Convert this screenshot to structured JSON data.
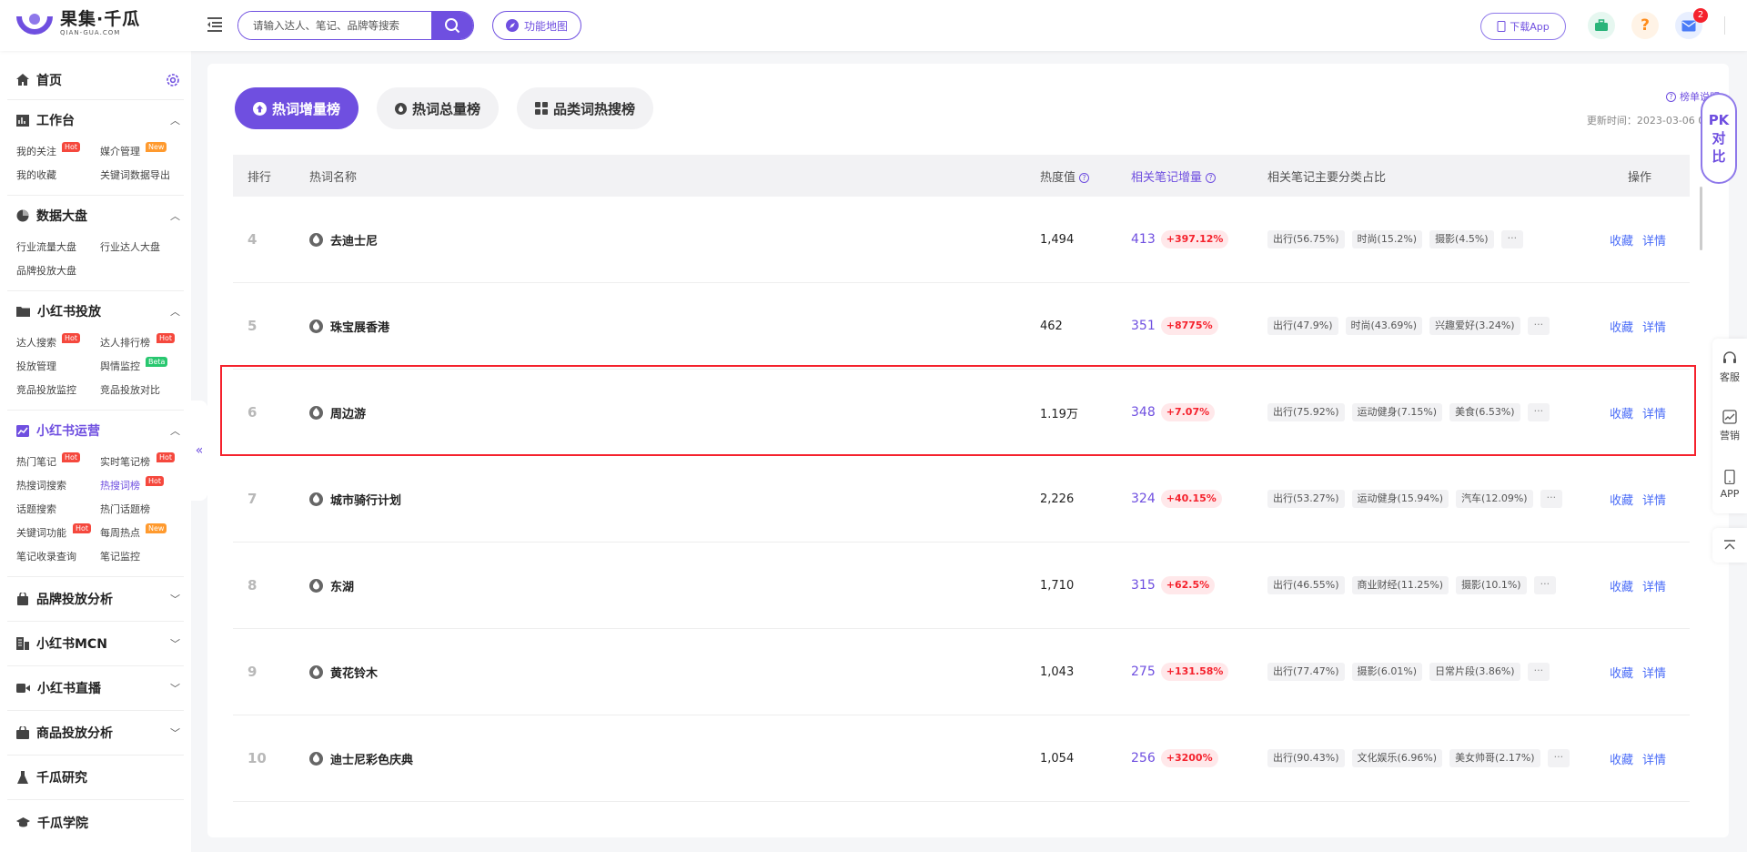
{
  "brand": {
    "name_cn": "果集·千瓜",
    "name_en": "QIAN-GUA.COM",
    "color": "#6f4fe0"
  },
  "search": {
    "placeholder": "请输入达人、笔记、品牌等搜索"
  },
  "header": {
    "func_map": "功能地图",
    "download_app": "下载App",
    "notifications": "2"
  },
  "sidebar": {
    "home": "首页",
    "sections": [
      {
        "title": "工作台",
        "items": [
          {
            "label": "我的关注",
            "tag": "Hot"
          },
          {
            "label": "媒介管理",
            "tag": "New"
          },
          {
            "label": "我的收藏"
          },
          {
            "label": "关键词数据导出"
          }
        ]
      },
      {
        "title": "数据大盘",
        "items": [
          {
            "label": "行业流量大盘"
          },
          {
            "label": "行业达人大盘"
          },
          {
            "label": "品牌投放大盘"
          }
        ]
      },
      {
        "title": "小红书投放",
        "items": [
          {
            "label": "达人搜索",
            "tag": "Hot"
          },
          {
            "label": "达人排行榜",
            "tag": "Hot"
          },
          {
            "label": "投放管理"
          },
          {
            "label": "舆情监控",
            "tag": "Beta"
          },
          {
            "label": "竞品投放监控"
          },
          {
            "label": "竞品投放对比"
          }
        ]
      },
      {
        "title": "小红书运营",
        "items": [
          {
            "label": "热门笔记",
            "tag": "Hot"
          },
          {
            "label": "实时笔记榜",
            "tag": "Hot"
          },
          {
            "label": "热搜词搜索"
          },
          {
            "label": "热搜词榜",
            "tag": "Hot"
          },
          {
            "label": "话题搜索"
          },
          {
            "label": "热门话题榜"
          },
          {
            "label": "关键词功能",
            "tag": "Hot"
          },
          {
            "label": "每周热点",
            "tag": "New"
          },
          {
            "label": "笔记收录查询"
          },
          {
            "label": "笔记监控"
          }
        ]
      }
    ],
    "collapsed": [
      "品牌投放分析",
      "小红书MCN",
      "小红书直播",
      "商品投放分析",
      "千瓜研究",
      "千瓜学院"
    ]
  },
  "tabs": [
    "热词增量榜",
    "热词总量榜",
    "品类词热搜榜"
  ],
  "rank_desc": "榜单说明",
  "update_time": "更新时间：2023-03-06 08:00",
  "table": {
    "headers": {
      "rank": "排行",
      "name": "热词名称",
      "heat": "热度值",
      "notes": "相关笔记增量",
      "dist": "相关笔记主要分类占比",
      "ops": "操作"
    },
    "rows": [
      {
        "rank": "4",
        "name": "去迪士尼",
        "heat": "1,494",
        "notes": "413",
        "growth": "+397.12%",
        "cats": [
          "出行(56.75%)",
          "时尚(15.2%)",
          "摄影(4.5%)"
        ]
      },
      {
        "rank": "5",
        "name": "珠宝展香港",
        "heat": "462",
        "notes": "351",
        "growth": "+8775%",
        "cats": [
          "出行(47.9%)",
          "时尚(43.69%)",
          "兴趣爱好(3.24%)"
        ]
      },
      {
        "rank": "6",
        "name": "周边游",
        "heat": "1.19万",
        "notes": "348",
        "growth": "+7.07%",
        "cats": [
          "出行(75.92%)",
          "运动健身(7.15%)",
          "美食(6.53%)"
        ]
      },
      {
        "rank": "7",
        "name": "城市骑行计划",
        "heat": "2,226",
        "notes": "324",
        "growth": "+40.15%",
        "cats": [
          "出行(53.27%)",
          "运动健身(15.94%)",
          "汽车(12.09%)"
        ]
      },
      {
        "rank": "8",
        "name": "东湖",
        "heat": "1,710",
        "notes": "315",
        "growth": "+62.5%",
        "cats": [
          "出行(46.55%)",
          "商业财经(11.25%)",
          "摄影(10.1%)"
        ]
      },
      {
        "rank": "9",
        "name": "黄花铃木",
        "heat": "1,043",
        "notes": "275",
        "growth": "+131.58%",
        "cats": [
          "出行(77.47%)",
          "摄影(6.01%)",
          "日常片段(3.86%)"
        ]
      },
      {
        "rank": "10",
        "name": "迪士尼彩色庆典",
        "heat": "1,054",
        "notes": "256",
        "growth": "+3200%",
        "cats": [
          "出行(90.43%)",
          "文化娱乐(6.96%)",
          "美女帅哥(2.17%)"
        ]
      }
    ],
    "op_collect": "收藏",
    "op_detail": "详情",
    "more": "···"
  },
  "pk": {
    "line1": "PK",
    "line2": "对",
    "line3": "比"
  },
  "side_tools": [
    "客服",
    "营销",
    "APP"
  ]
}
